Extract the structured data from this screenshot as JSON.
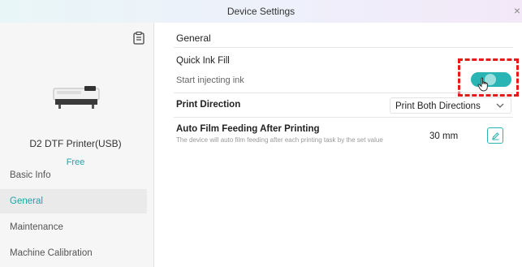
{
  "window": {
    "title": "Device Settings",
    "close_glyph": "×"
  },
  "sidebar": {
    "device_name": "D2 DTF Printer(USB)",
    "device_status": "Free",
    "items": [
      {
        "label": "Basic Info",
        "active": false
      },
      {
        "label": "General",
        "active": true
      },
      {
        "label": "Maintenance",
        "active": false
      },
      {
        "label": "Machine Calibration",
        "active": false
      }
    ]
  },
  "main": {
    "section_title": "General",
    "quick_ink_fill": {
      "label": "Quick Ink Fill",
      "sub_label": "Start injecting ink",
      "toggle_on": true
    },
    "print_direction": {
      "label": "Print Direction",
      "selected": "Print Both Directions"
    },
    "auto_film_feeding": {
      "label": "Auto Film Feeding After Printing",
      "description": "The device will auto film feeding after each printing task by the set value",
      "value": "30 mm"
    }
  },
  "icons": {
    "document": "document-icon",
    "printer": "printer-icon",
    "chevron": "chevron-down-icon",
    "edit": "pencil-icon",
    "cursor": "hand-cursor-icon"
  },
  "colors": {
    "accent": "#2ab5b5",
    "highlight": "#e31b1b"
  }
}
